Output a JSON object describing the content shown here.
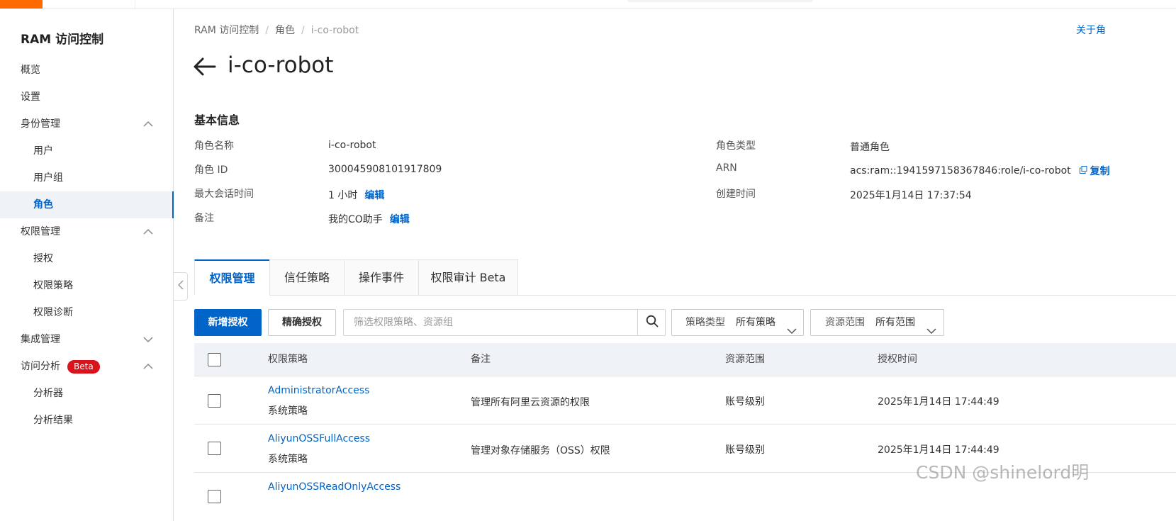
{
  "sidebar": {
    "title": "RAM 访问控制",
    "items": [
      {
        "label": "概览"
      },
      {
        "label": "设置"
      },
      {
        "label": "身份管理"
      },
      {
        "label": "用户"
      },
      {
        "label": "用户组"
      },
      {
        "label": "角色"
      },
      {
        "label": "权限管理"
      },
      {
        "label": "授权"
      },
      {
        "label": "权限策略"
      },
      {
        "label": "权限诊断"
      },
      {
        "label": "集成管理"
      },
      {
        "label": "访问分析",
        "badge": "Beta"
      },
      {
        "label": "分析器"
      },
      {
        "label": "分析结果"
      }
    ],
    "active_item": "角色"
  },
  "breadcrumb": [
    "RAM 访问控制",
    "角色",
    "i-co-robot"
  ],
  "doc_link": "关于角",
  "page": {
    "title": "i-co-robot"
  },
  "basic_info": {
    "title": "基本信息",
    "role_name": {
      "label": "角色名称",
      "value": "i-co-robot"
    },
    "role_id": {
      "label": "角色 ID",
      "value": "300045908101917809"
    },
    "max_session": {
      "label": "最大会话时间",
      "value": "1 小时",
      "edit": "编辑"
    },
    "remark": {
      "label": "备注",
      "value": "我的CO助手",
      "edit": "编辑"
    },
    "role_type": {
      "label": "角色类型",
      "value": "普通角色"
    },
    "arn": {
      "label": "ARN",
      "value": "acs:ram::1941597158367846:role/i-co-robot",
      "copy": "复制"
    },
    "created": {
      "label": "创建时间",
      "value": "2025年1月14日 17:37:54"
    }
  },
  "tabs": [
    {
      "label": "权限管理",
      "active": true
    },
    {
      "label": "信任策略"
    },
    {
      "label": "操作事件"
    },
    {
      "label": "权限审计 Beta"
    }
  ],
  "toolbar": {
    "add_grant": "新增授权",
    "precise_grant": "精确授权",
    "search_placeholder": "筛选权限策略、资源组",
    "policy_type_label": "策略类型",
    "policy_type_value": "所有策略",
    "resource_scope_label": "资源范围",
    "resource_scope_value": "所有范围"
  },
  "table": {
    "columns": [
      "权限策略",
      "备注",
      "资源范围",
      "授权时间"
    ],
    "rows": [
      {
        "policy": "AdministratorAccess",
        "type": "系统策略",
        "remark": "管理所有阿里云资源的权限",
        "scope": "账号级别",
        "time": "2025年1月14日 17:44:49"
      },
      {
        "policy": "AliyunOSSFullAccess",
        "type": "系统策略",
        "remark": "管理对象存储服务（OSS）权限",
        "scope": "账号级别",
        "time": "2025年1月14日 17:44:49"
      },
      {
        "policy": "AliyunOSSReadOnlyAccess"
      }
    ]
  },
  "watermark": "CSDN @shinelord明",
  "colors": {
    "accent": "#0064c8",
    "brand": "#ff6a00",
    "beta_badge": "#d9141c"
  }
}
